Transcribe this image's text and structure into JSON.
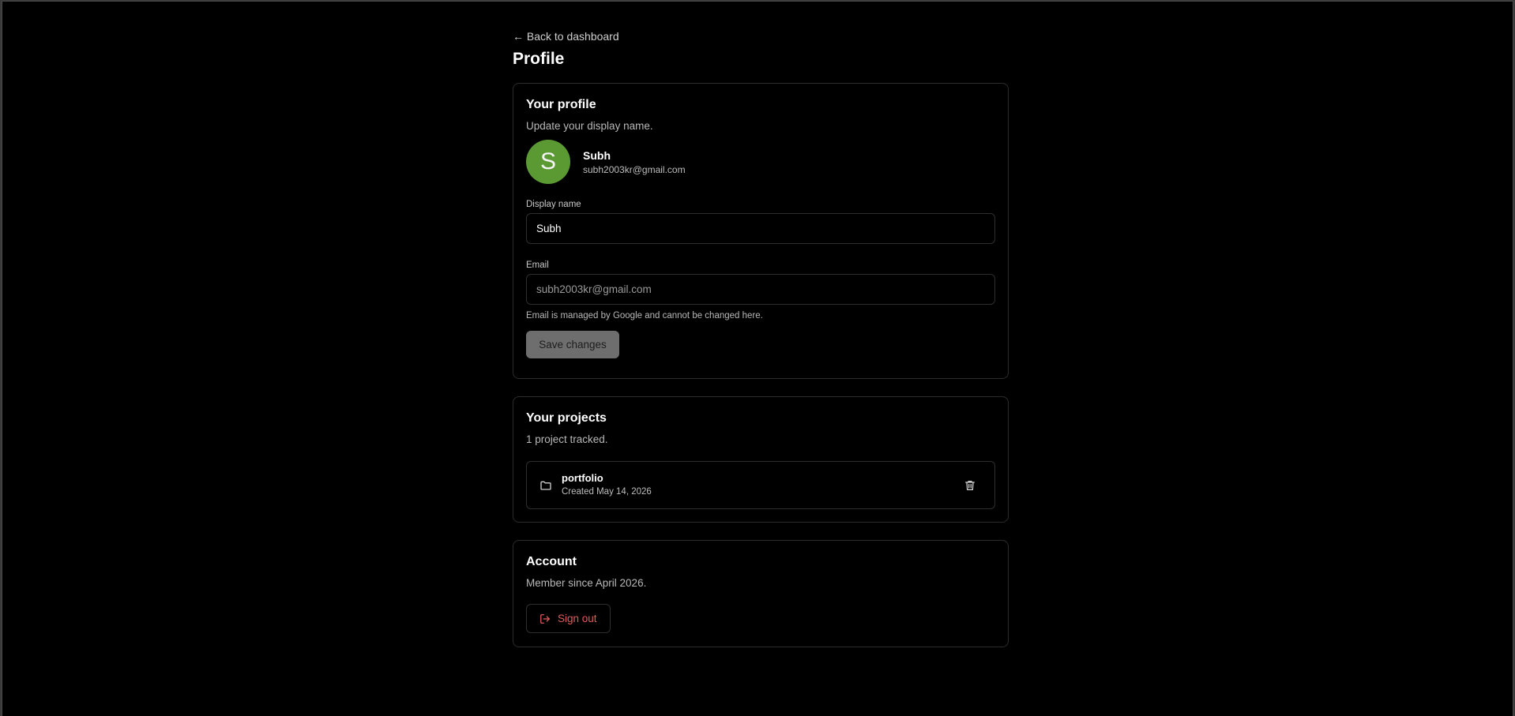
{
  "nav": {
    "back_label": "← Back to dashboard"
  },
  "page": {
    "title": "Profile"
  },
  "profile": {
    "title": "Your profile",
    "description": "Update your display name.",
    "avatar_initial": "S",
    "avatar_color": "#5b9a32",
    "user_name": "Subh",
    "user_email": "subh2003kr@gmail.com",
    "display_name_label": "Display name",
    "display_name_value": "Subh",
    "email_label": "Email",
    "email_value": "subh2003kr@gmail.com",
    "email_help": "Email is managed by Google and cannot be changed here.",
    "save_label": "Save changes"
  },
  "projects": {
    "title": "Your projects",
    "description": "1 project tracked.",
    "items": [
      {
        "name": "portfolio",
        "created": "Created May 14, 2026",
        "icon": "folder-icon",
        "action_icon": "trash-icon"
      }
    ]
  },
  "account": {
    "title": "Account",
    "description": "Member since April 2026.",
    "signout_label": "Sign out",
    "signout_icon": "logout-icon",
    "signout_color": "#e05a5a"
  }
}
